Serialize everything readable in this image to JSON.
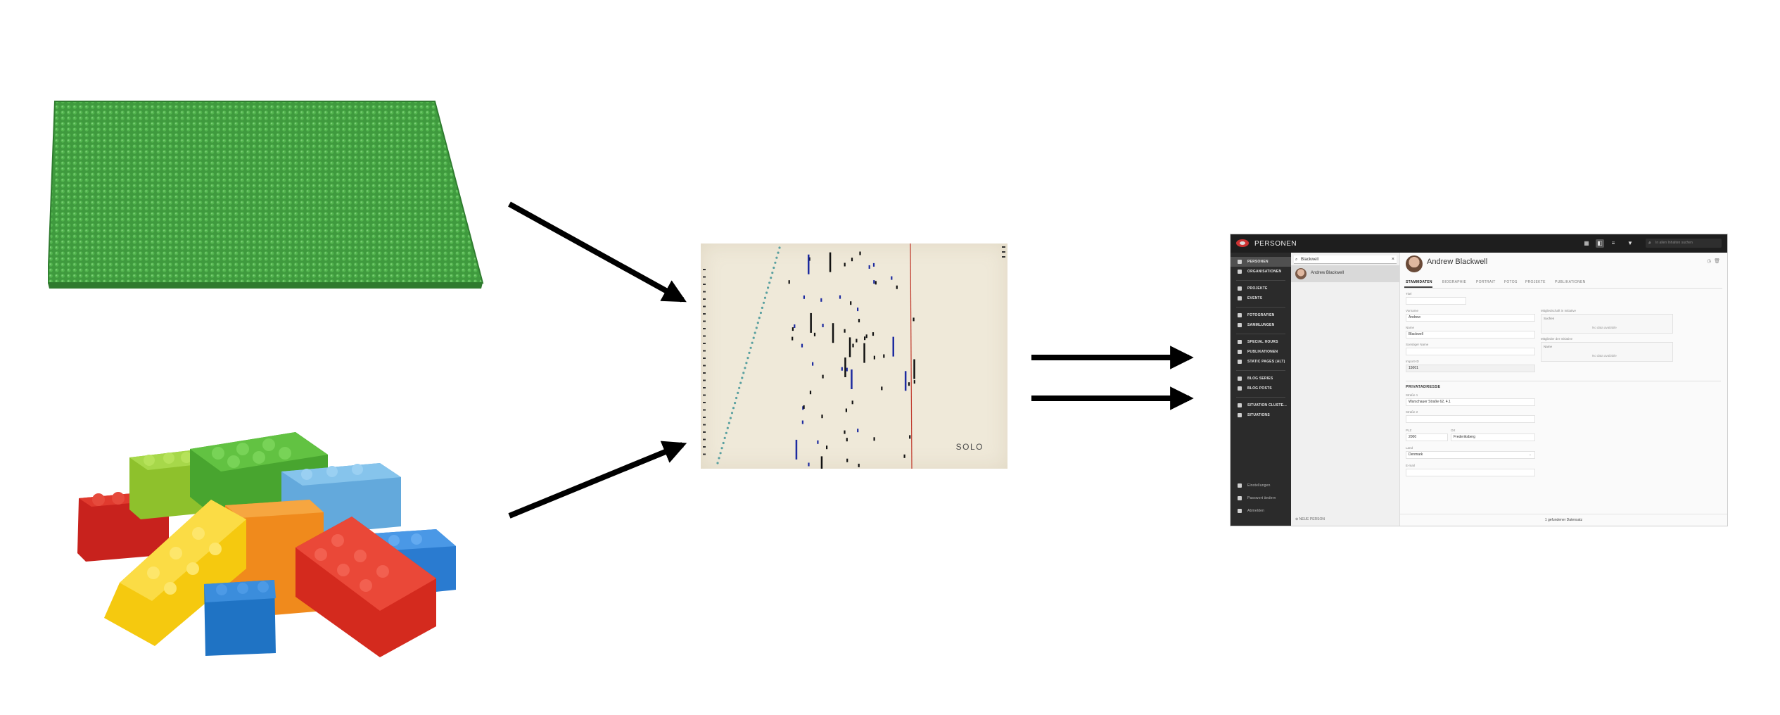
{
  "score": {
    "label": "SOLO",
    "accent": "#c0392b",
    "dots": "#5aa0a0",
    "notes_blue": "#1c2aa0"
  },
  "colors": {
    "baseplate": "#3f9a3e",
    "arrow": "#000000"
  },
  "app": {
    "title": "PERSONEN",
    "search_placeholder": "In allen Inhalten suchen",
    "icons": {
      "calendar": "calendar-icon",
      "split": "split-view-icon",
      "list": "list-view-icon",
      "filter": "filter-icon"
    },
    "sidebar": {
      "items": [
        {
          "label": "PERSONEN"
        },
        {
          "label": "ORGANISATIONEN"
        },
        {
          "label": "PROJEKTE"
        },
        {
          "label": "EVENTS"
        },
        {
          "label": "FOTOGRAFIEN"
        },
        {
          "label": "SAMMLUNGEN"
        },
        {
          "label": "SPECIAL HOURS"
        },
        {
          "label": "PUBLIKATIONEN"
        },
        {
          "label": "STATIC PAGES (ALT)"
        },
        {
          "label": "BLOG SERIES"
        },
        {
          "label": "BLOG POSTS"
        },
        {
          "label": "SITUATION CLUSTE..."
        },
        {
          "label": "SITUATIONS"
        }
      ],
      "footer": [
        {
          "label": "Einstellungen"
        },
        {
          "label": "Passwort ändern"
        },
        {
          "label": "Abmelden"
        }
      ]
    },
    "list": {
      "search_value": "Blackwell",
      "results": [
        {
          "name": "Andrew Blackwell"
        }
      ],
      "new_label": "NEUE PERSON"
    },
    "detail": {
      "name": "Andrew Blackwell",
      "tabs": [
        "STAMMDATEN",
        "BIOGRAPHIE",
        "PORTRAIT",
        "FOTOS",
        "PROJEKTE",
        "PUBLIKATIONEN"
      ],
      "fields": {
        "titel": {
          "label": "Titel",
          "value": ""
        },
        "vorname": {
          "label": "Vorname",
          "value": "Andrew"
        },
        "name": {
          "label": "Name",
          "value": "Blackwell"
        },
        "sonstiger_name": {
          "label": "Sonstiger Name",
          "value": ""
        },
        "import_id": {
          "label": "Import-ID",
          "value": "15001"
        },
        "mitgliedschaft": {
          "label": "Mitgliedschaft in Initiative",
          "value": "Suchen",
          "nodata": "No data available"
        },
        "mitglied": {
          "label": "Mitglieder der Initiative",
          "value": "Name",
          "nodata": "No data available"
        }
      },
      "privat": {
        "heading": "PRIVATADRESSE",
        "strasse1": {
          "label": "Straße 1",
          "value": "Warschauer Straße 62, 4.1"
        },
        "strasse2": {
          "label": "Straße 2",
          "value": ""
        },
        "plz": {
          "label": "PLZ",
          "value": "2000"
        },
        "ort": {
          "label": "Ort",
          "value": "Frederiksberg"
        },
        "land": {
          "label": "Land",
          "value": "Denmark"
        },
        "email": {
          "label": "E-mail",
          "value": ""
        }
      },
      "status": "1 gefundener Datensatz"
    }
  }
}
